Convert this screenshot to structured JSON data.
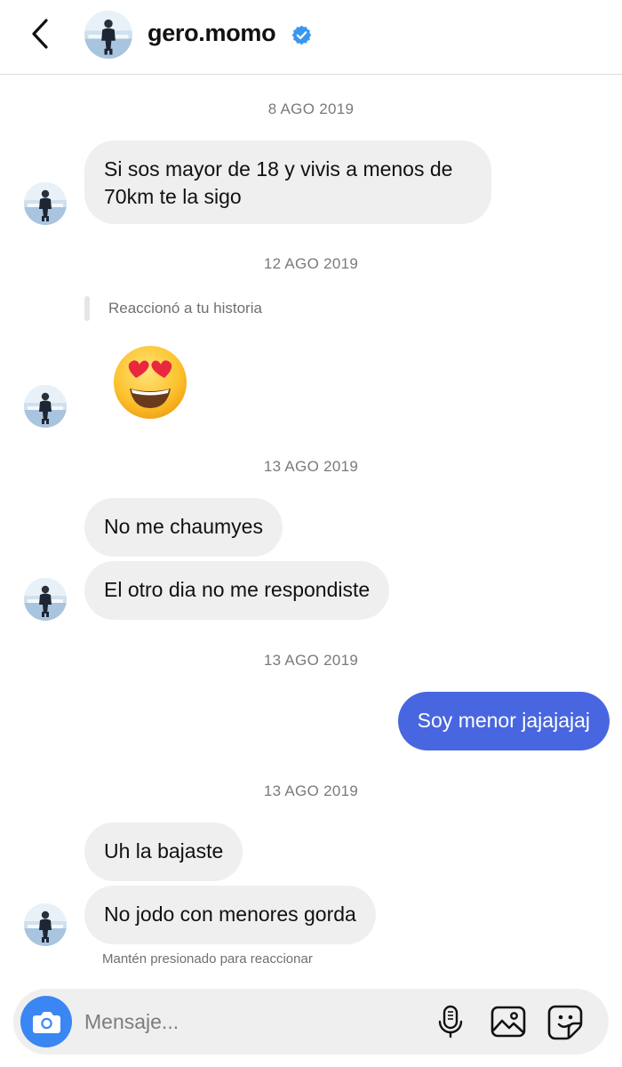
{
  "header": {
    "username": "gero.momo",
    "verified": true,
    "back_icon": "chevron-left-icon"
  },
  "thread": {
    "timestamps": [
      "8 AGO 2019",
      "12 AGO 2019",
      "13 AGO 2019",
      "13 AGO 2019",
      "13 AGO 2019"
    ],
    "messages": [
      {
        "from": "them",
        "text_line1": "Si sos mayor de 18 y vivis a menos de",
        "text_line2": "70km te la sigo"
      },
      {
        "from": "them",
        "story_reply": "Reaccionó a tu historia",
        "emoji": "smiling-face-with-heart-eyes"
      },
      {
        "from": "them",
        "text": "No me chaumyes"
      },
      {
        "from": "them",
        "text": "El otro dia no me respondiste"
      },
      {
        "from": "me",
        "text": "Soy menor jajajajaj"
      },
      {
        "from": "them",
        "text": "Uh la bajaste"
      },
      {
        "from": "them",
        "text": "No jodo con menores gorda"
      }
    ],
    "reaction_hint": "Mantén presionado para reaccionar"
  },
  "composer": {
    "placeholder": "Mensaje...",
    "icons": [
      "camera-icon",
      "microphone-icon",
      "gallery-icon",
      "sticker-icon"
    ]
  },
  "colors": {
    "incoming_bubble": "#efefef",
    "outgoing_bubble": "#4866e0",
    "verified_badge": "#3897f0",
    "camera_button": "#3a86f3"
  }
}
